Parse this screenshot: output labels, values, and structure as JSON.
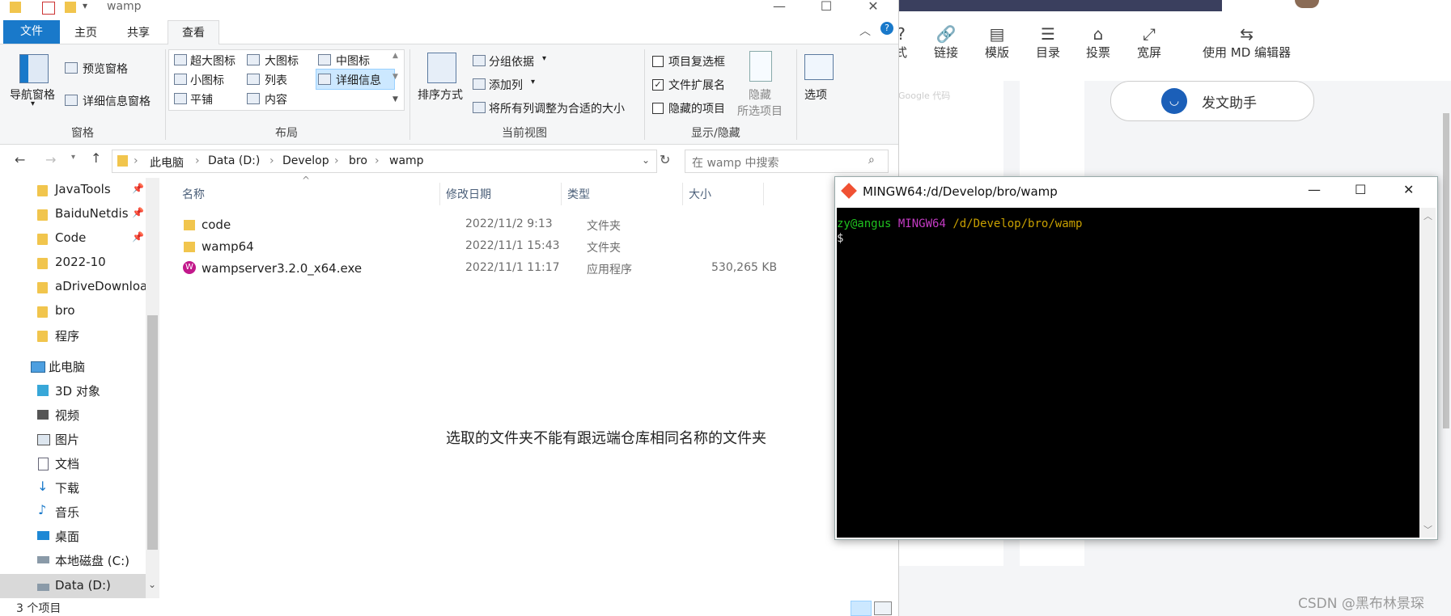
{
  "explorer": {
    "title": "wamp",
    "tabs": [
      "文件",
      "主页",
      "共享",
      "查看"
    ],
    "ribbon": {
      "pane_group": {
        "nav_pane": "导航窗格",
        "preview_pane": "预览窗格",
        "details_pane": "详细信息窗格",
        "label": "窗格"
      },
      "layout_group": {
        "items": [
          "超大图标",
          "大图标",
          "中图标",
          "小图标",
          "列表",
          "详细信息",
          "平铺",
          "内容"
        ],
        "label": "布局"
      },
      "view_group": {
        "sort_by": "排序方式",
        "group_by": "分组依据",
        "add_column": "添加列",
        "fit_columns": "将所有列调整为合适的大小",
        "label": "当前视图"
      },
      "show_hide_group": {
        "item_checkboxes": "项目复选框",
        "file_ext": "文件扩展名",
        "hidden_items": "隐藏的项目",
        "hide_selected_1": "隐藏",
        "hide_selected_2": "所选项目",
        "options": "选项",
        "label": "显示/隐藏"
      }
    },
    "address": {
      "crumbs": [
        "此电脑",
        "Data (D:)",
        "Develop",
        "bro",
        "wamp"
      ],
      "search_placeholder": "在 wamp 中搜索"
    },
    "nav": {
      "quick": [
        "JavaTools",
        "BaiduNetdis",
        "Code",
        "2022-10",
        "aDriveDownloa",
        "bro",
        "程序"
      ],
      "this_pc": "此电脑",
      "pc_items": [
        "3D 对象",
        "视频",
        "图片",
        "文档",
        "下载",
        "音乐",
        "桌面",
        "本地磁盘 (C:)",
        "Data (D:)"
      ]
    },
    "columns": [
      "名称",
      "修改日期",
      "类型",
      "大小"
    ],
    "files": [
      {
        "name": "code",
        "date": "2022/11/2 9:13",
        "type": "文件夹",
        "size": ""
      },
      {
        "name": "wamp64",
        "date": "2022/11/1 15:43",
        "type": "文件夹",
        "size": ""
      },
      {
        "name": "wampserver3.2.0_x64.exe",
        "date": "2022/11/1 11:17",
        "type": "应用程序",
        "size": "530,265 KB"
      }
    ],
    "annotation": "选取的文件夹不能有跟远端仓库相同名称的文件夹",
    "status": "3 个项目"
  },
  "csdn": {
    "toolbar": [
      "式",
      "链接",
      "模版",
      "目录",
      "投票",
      "宽屏",
      "使用 MD 编辑器"
    ],
    "assistant": "发文助手",
    "google_hint": "Google 代码",
    "watermark": "CSDN @黑布林景琛"
  },
  "terminal": {
    "title": "MINGW64:/d/Develop/bro/wamp",
    "prompt_user": "zy@angus",
    "prompt_env": "MINGW64",
    "prompt_path": "/d/Develop/bro/wamp",
    "prompt_symbol": "$"
  },
  "colors": {
    "accent": "#1979ca",
    "term_user": "#1fc11f",
    "term_env": "#c43bc4",
    "term_path": "#c8a000"
  }
}
